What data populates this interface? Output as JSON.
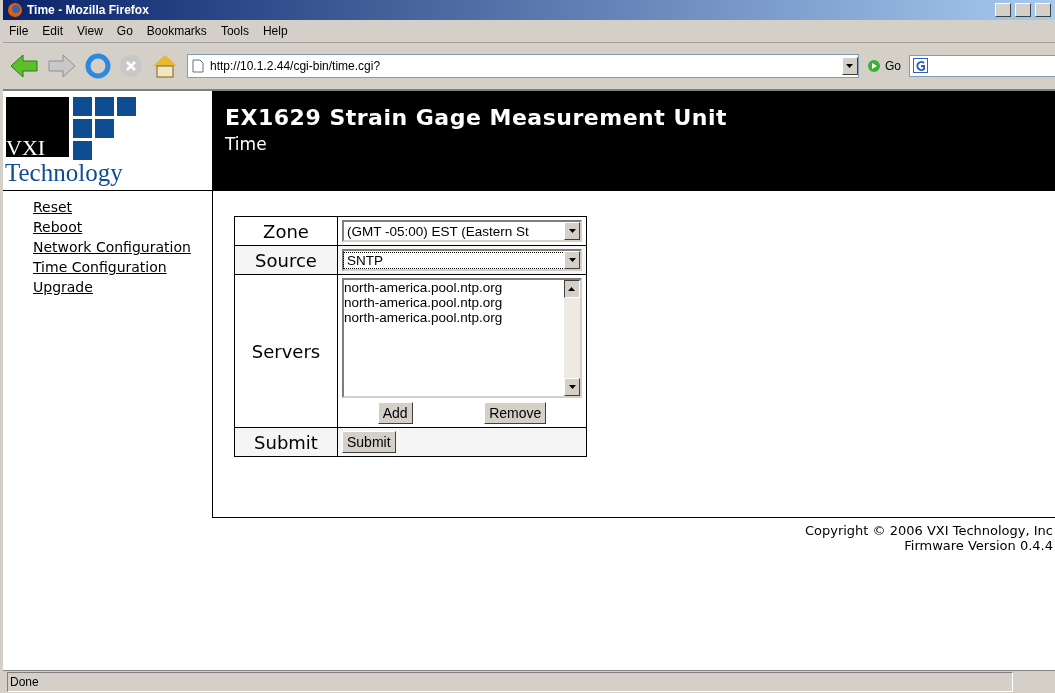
{
  "window": {
    "title": "Time - Mozilla Firefox"
  },
  "menu": [
    "File",
    "Edit",
    "View",
    "Go",
    "Bookmarks",
    "Tools",
    "Help"
  ],
  "toolbar": {
    "url": "http://10.1.2.44/cgi-bin/time.cgi?",
    "go": "Go"
  },
  "logo": {
    "line1": "VXI",
    "line2": "Technology"
  },
  "header": {
    "title": "EX1629 Strain Gage Measurement Unit",
    "subtitle": "Time"
  },
  "nav": [
    "Reset",
    "Reboot",
    "Network Configuration",
    "Time Configuration",
    "Upgrade"
  ],
  "form": {
    "zone": {
      "label": "Zone",
      "value": "(GMT -05:00) EST (Eastern St"
    },
    "source": {
      "label": "Source",
      "value": "SNTP"
    },
    "servers": {
      "label": "Servers",
      "items": [
        "north-america.pool.ntp.org",
        "north-america.pool.ntp.org",
        "north-america.pool.ntp.org"
      ],
      "add": "Add",
      "remove": "Remove"
    },
    "submit": {
      "label": "Submit",
      "button": "Submit"
    }
  },
  "footer": [
    "Copyright © 2006 VXI Technology, Inc",
    "Firmware Version 0.4.4"
  ],
  "status_bar": "Done"
}
